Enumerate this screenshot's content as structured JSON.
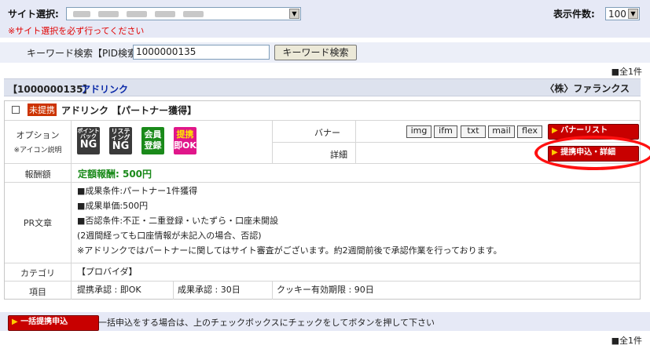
{
  "top_bar": {
    "site_label": "サイト選択:",
    "site_warning": "※サイト選択を必ず行ってください",
    "count_label": "表示件数:",
    "count_value": "100"
  },
  "keyword": {
    "label": "キーワード検索【PID検索】",
    "value": "1000000135",
    "button": "キーワード検索"
  },
  "total_top": "■全1件",
  "program": {
    "header_id": "【1000000135】",
    "header_name": "アドリンク",
    "advertiser": "〈株〉ファランクス",
    "status_tag": "未提携",
    "title": "アドリンク 【パートナー獲得】"
  },
  "options": {
    "label": "オプション",
    "icon_help": "※アイコン説明",
    "icons": [
      {
        "line1": "ポイント",
        "line2": "バック",
        "ng": "NG",
        "color": "#333333"
      },
      {
        "line1": "リステ",
        "line2": "ィング",
        "ng": "NG",
        "color": "#333333"
      },
      {
        "line1": "会員",
        "line2": "登録",
        "color": "#1a8a1a"
      },
      {
        "line1": "提携",
        "line2": "即OK",
        "color": "#e0168a"
      }
    ]
  },
  "banner": {
    "label": "バナー",
    "chips": [
      "img",
      "ifm",
      "txt",
      "mail",
      "flex"
    ],
    "list_button": "バナーリスト"
  },
  "detail": {
    "label": "詳細",
    "apply_button": "提携申込・詳細"
  },
  "reward": {
    "label": "報酬額",
    "value": "定額報酬: 500円"
  },
  "pr": {
    "label": "PR文章",
    "lines": [
      "■成果条件:パートナー1件獲得",
      "■成果単価:500円",
      "■否認条件:不正・二重登録・いたずら・口座未開設",
      "(2週間経っても口座情報が未記入の場合、否認)",
      "※アドリンクではパートナーに関してはサイト審査がございます。約2週間前後で承認作業を行っております。"
    ]
  },
  "category": {
    "label": "カテゴリ",
    "value": "【プロバイダ】"
  },
  "items": {
    "label": "項目",
    "approval": "提携承認 : 即OK",
    "result": "成果承認 : 30日",
    "cookie": "クッキー有効期限 : 90日"
  },
  "bulk": {
    "button": "一括提携申込",
    "note": "一括申込をする場合は、上のチェックボックスにチェックをしてボタンを押して下さい"
  },
  "total_bottom": "■全1件",
  "colors": {
    "accent_red": "#c80000",
    "link_blue": "#0b2aa8",
    "header_bg": "#dde2ee"
  }
}
